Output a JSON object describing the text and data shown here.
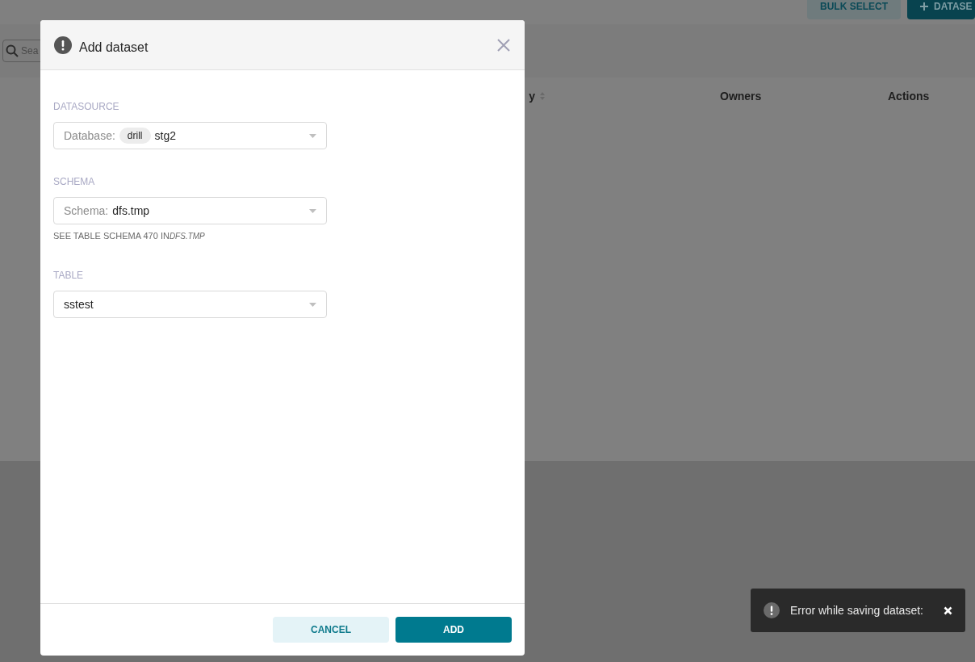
{
  "top_buttons": [
    {
      "label": "BULK SELECT",
      "kind": "secondary"
    },
    {
      "label": "DATASE",
      "kind": "primary"
    }
  ],
  "search": {
    "placeholder": "Sea"
  },
  "table": {
    "columns": [
      {
        "label": "y",
        "sortable": true
      },
      {
        "label": "Owners",
        "sortable": false
      },
      {
        "label": "Actions",
        "sortable": false
      }
    ]
  },
  "modal": {
    "title": "Add dataset",
    "fields": [
      {
        "label": "DATASOURCE",
        "prefix": "Database:",
        "tag": "drill",
        "value": "stg2"
      },
      {
        "label": "SCHEMA",
        "prefix": "Schema:",
        "value": "dfs.tmp",
        "help": {
          "text": "SEE TABLE SCHEMA 470 IN",
          "object": "DFS.TMP"
        }
      },
      {
        "label": "TABLE",
        "value": "sstest"
      }
    ],
    "buttons": [
      {
        "label": "CANCEL",
        "kind": "secondary"
      },
      {
        "label": "ADD",
        "kind": "primary"
      }
    ]
  },
  "toast": {
    "message": "Error while saving dataset:"
  }
}
